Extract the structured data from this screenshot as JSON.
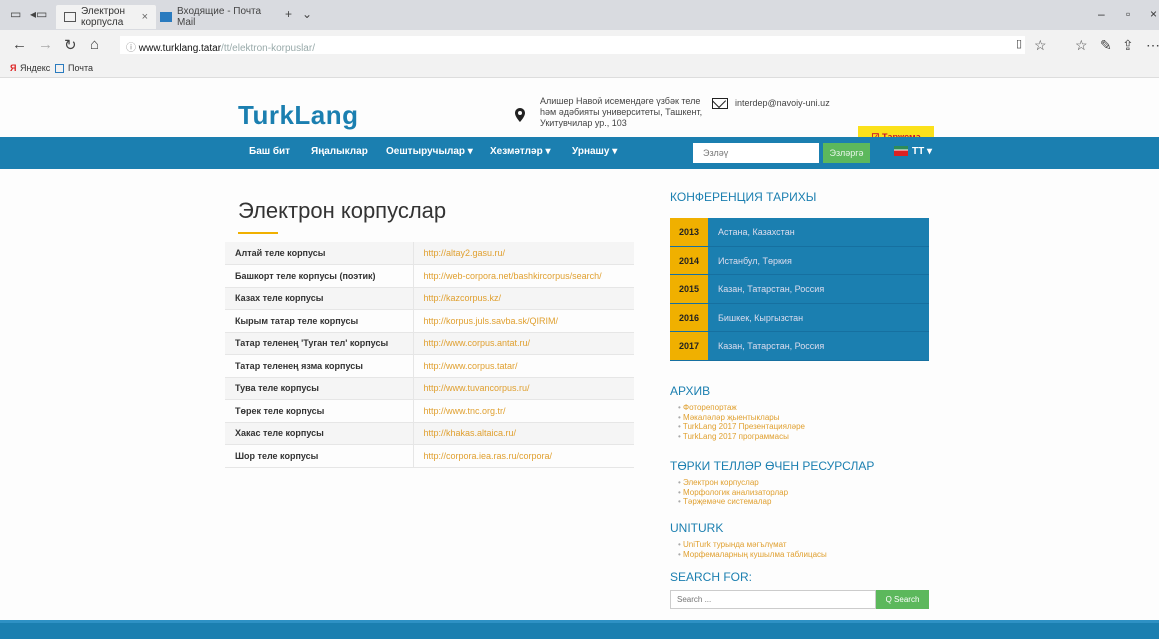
{
  "browser": {
    "tabs": [
      {
        "label": "Электрон корпусла",
        "close": "×"
      },
      {
        "label": "Входящие - Почта Mail"
      }
    ],
    "new_tab": "+",
    "url_host": "www.turklang.tatar",
    "url_path": "/tt/elektron-korpuslar/",
    "bookmarks": [
      "Яндекс",
      "Почта"
    ]
  },
  "site": {
    "logo": "TurkLang",
    "address": "Алишер Навоӣ исемендәге үзбәк теле һәм әдәбияты университеты, Ташкент, Укитувчилар ур., 103",
    "email": "interdep@navoiy-uni.uz",
    "translate_button": "Тәржемә",
    "nav": [
      "Баш бит",
      "Яңалыклар",
      "Оештыручылар ▾",
      "Хезмәтләр ▾",
      "Урнашу ▾"
    ],
    "search_placeholder": "Эзләү",
    "search_button": "Эзләргә",
    "lang": "TT ▾"
  },
  "main": {
    "title": "Электрон корпуслар",
    "corpora": [
      {
        "name": "Алтай теле корпусы",
        "url": "http://altay2.gasu.ru/"
      },
      {
        "name": "Башкорт теле корпусы (поэтик)",
        "url": "http://web-corpora.net/bashkircorpus/search/"
      },
      {
        "name": "Казах теле корпусы",
        "url": "http://kazcorpus.kz/"
      },
      {
        "name": "Кырым татар теле корпусы",
        "url": "http://korpus.juls.savba.sk/QIRIM/"
      },
      {
        "name": "Татар теленең 'Туган тел' корпусы",
        "url": "http://www.corpus.antat.ru/"
      },
      {
        "name": "Татар теленең язма корпусы",
        "url": "http://www.corpus.tatar/"
      },
      {
        "name": "Тува теле корпусы",
        "url": "http://www.tuvancorpus.ru/"
      },
      {
        "name": "Төрек теле корпусы",
        "url": "http://www.tnc.org.tr/"
      },
      {
        "name": "Хакас теле корпусы",
        "url": "http://khakas.altaica.ru/"
      },
      {
        "name": "Шор теле корпусы",
        "url": "http://corpora.iea.ras.ru/corpora/"
      }
    ]
  },
  "sidebar": {
    "history_title": "КОНФЕРЕНЦИЯ ТАРИХЫ",
    "history": [
      {
        "year": "2013",
        "place": "Астана, Казахстан"
      },
      {
        "year": "2014",
        "place": "Истанбул, Төркия"
      },
      {
        "year": "2015",
        "place": "Казан, Татарстан, Россия"
      },
      {
        "year": "2016",
        "place": "Бишкек, Кыргызстан"
      },
      {
        "year": "2017",
        "place": "Казан, Татарстан, Россия"
      }
    ],
    "archive_title": "АРХИВ",
    "archive": [
      "Фоторепортаж",
      "Мәкаләләр җыентыклары",
      "TurkLang 2017 Презентацияләре",
      "TurkLang 2017 программасы"
    ],
    "resources_title": "ТӨРКИ ТЕЛЛӘР ӨЧЕН РЕСУРСЛАР",
    "resources": [
      "Электрон корпуслар",
      "Морфологик анализаторлар",
      "Тәрҗемәче системалар"
    ],
    "uniturk_title": "UNITURK",
    "uniturk": [
      "UniTurk турында мәгълүмат",
      "Морфемаларның кушылма таблицасы"
    ],
    "search_title": "SEARCH FOR:",
    "search_placeholder": "Search ...",
    "search_button": "Q Search"
  }
}
